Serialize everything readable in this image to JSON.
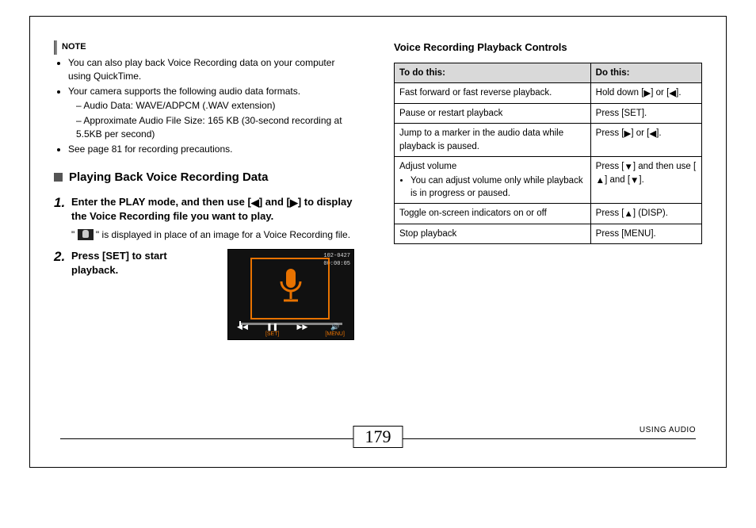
{
  "note": {
    "label": "NOTE",
    "items": [
      "You can also play back Voice Recording data on your computer using QuickTime.",
      "Your camera supports the following audio data formats.",
      "See page 81 for recording precautions."
    ],
    "subitems": [
      "Audio Data: WAVE/ADPCM (.WAV extension)",
      "Approximate Audio File Size: 165 KB (30-second recording at 5.5KB per second)"
    ]
  },
  "section": {
    "title": "Playing Back Voice Recording Data"
  },
  "steps": {
    "s1": {
      "num": "1.",
      "title_a": "Enter the PLAY mode, and then use [",
      "title_b": "] and [",
      "title_c": "] to display the Voice Recording file you want to play.",
      "sub_a": "\" ",
      "sub_b": " \" is displayed in place of an image for a Voice Recording file."
    },
    "s2": {
      "num": "2.",
      "title": "Press [SET] to start playback."
    }
  },
  "lcd": {
    "file": "102-0427",
    "time": "00:00:05",
    "btns": [
      "◀◀",
      "❚❚",
      "▶▶",
      "🔊"
    ],
    "labs": [
      "",
      "[SET]",
      "",
      "[MENU]"
    ]
  },
  "table": {
    "title": "Voice Recording Playback Controls",
    "head": {
      "a": "To do this:",
      "b": "Do this:"
    },
    "rows": [
      {
        "a": "Fast forward or fast reverse playback.",
        "b_pre": "Hold down [",
        "b_mid": "] or [",
        "b_post": "]."
      },
      {
        "a": "Pause or restart playback",
        "b": "Press [SET]."
      },
      {
        "a": "Jump to a marker in the audio data while playback is paused.",
        "b_pre": "Press [",
        "b_mid": "] or [",
        "b_post": "]."
      },
      {
        "a": "Adjust volume",
        "a_sub": "You can adjust volume only while playback is in progress or paused.",
        "b_pre": "Press [",
        "b_mid": "] and then use [",
        "b_mid2": "] and [",
        "b_post": "]."
      },
      {
        "a": "Toggle on-screen indicators on or off",
        "b_pre": "Press [",
        "b_post": "] (DISP)."
      },
      {
        "a": "Stop playback",
        "b": "Press [MENU]."
      }
    ]
  },
  "footer": {
    "page": "179",
    "section": "USING AUDIO"
  }
}
